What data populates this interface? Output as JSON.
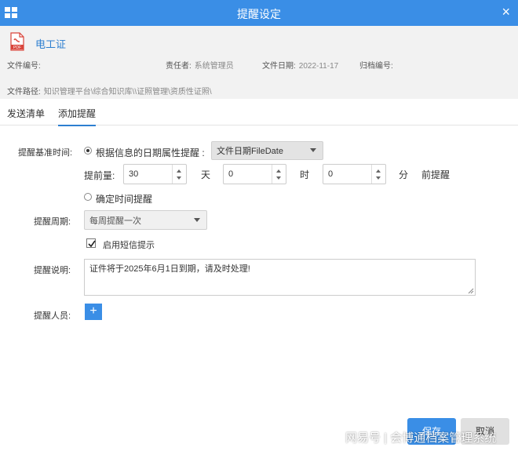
{
  "window": {
    "title": "提醒设定"
  },
  "file": {
    "name": "电工证",
    "icon_text": "PDF",
    "number_label": "文件编号:",
    "number_value": "",
    "owner_label": "责任者:",
    "owner_value": "系统管理员",
    "date_label": "文件日期:",
    "date_value": "2022-11-17",
    "archive_label": "归档编号:",
    "archive_value": "",
    "path_label": "文件路径:",
    "path_value": "知识管理平台\\综合知识库\\\\证照管理\\资质性证照\\"
  },
  "tabs": [
    {
      "label": "发送清单",
      "active": false
    },
    {
      "label": "添加提醒",
      "active": true
    }
  ],
  "form": {
    "base_time_label": "提醒基准时间:",
    "option1_label": "根据信息的日期属性提醒 :",
    "option1_selected": true,
    "date_attr_select": "文件日期FileDate",
    "advance_label": "提前量:",
    "days_value": "30",
    "days_unit": "天",
    "hours_value": "0",
    "hours_unit": "时",
    "minutes_value": "0",
    "minutes_unit": "分",
    "advance_suffix": "前提醒",
    "option2_label": "确定时间提醒",
    "option2_selected": false,
    "cycle_label": "提醒周期:",
    "cycle_select": "每周提醒一次",
    "sms_label": "启用短信提示",
    "sms_checked": true,
    "desc_label": "提醒说明:",
    "desc_value": "证件将于2025年6月1日到期，请及时处理!",
    "people_label": "提醒人员:",
    "add_symbol": "+"
  },
  "buttons": {
    "save": "保存",
    "cancel": "取消"
  },
  "watermark": "网易号 | 会博通档案管理系统",
  "colors": {
    "accent": "#3a8ee6",
    "link": "#2d7fd0",
    "pdf": "#d9443a"
  }
}
